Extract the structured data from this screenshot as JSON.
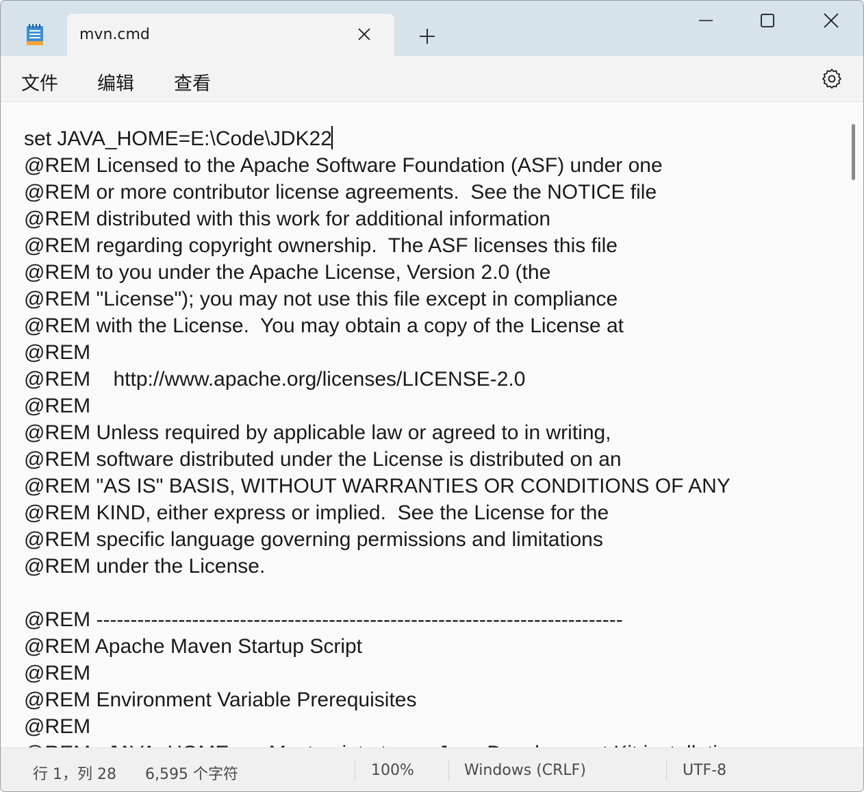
{
  "tab": {
    "title": "mvn.cmd",
    "close_icon": "close-icon",
    "new_tab_icon": "plus-icon"
  },
  "menu": {
    "file": "文件",
    "edit": "编辑",
    "view": "查看",
    "settings_icon": "gear-icon"
  },
  "editor": {
    "content": "set JAVA_HOME=E:\\Code\\JDK22\n@REM Licensed to the Apache Software Foundation (ASF) under one\n@REM or more contributor license agreements.  See the NOTICE file\n@REM distributed with this work for additional information\n@REM regarding copyright ownership.  The ASF licenses this file\n@REM to you under the Apache License, Version 2.0 (the\n@REM \"License\"); you may not use this file except in compliance\n@REM with the License.  You may obtain a copy of the License at\n@REM\n@REM    http://www.apache.org/licenses/LICENSE-2.0\n@REM\n@REM Unless required by applicable law or agreed to in writing,\n@REM software distributed under the License is distributed on an\n@REM \"AS IS\" BASIS, WITHOUT WARRANTIES OR CONDITIONS OF ANY\n@REM KIND, either express or implied.  See the License for the\n@REM specific language governing permissions and limitations\n@REM under the License.\n\n@REM -----------------------------------------------------------------------------\n@REM Apache Maven Startup Script\n@REM\n@REM Environment Variable Prerequisites\n@REM\n@REM   JAVA_HOME       Must point at your Java Development Kit installation."
  },
  "status": {
    "position": "行 1，列 28",
    "char_count": "6,595 个字符",
    "zoom": "100%",
    "line_ending": "Windows (CRLF)",
    "encoding": "UTF-8"
  },
  "colors": {
    "titlebar": "#d6e3ea",
    "tab": "#f3f3f3",
    "editor_bg": "#fafafa"
  }
}
